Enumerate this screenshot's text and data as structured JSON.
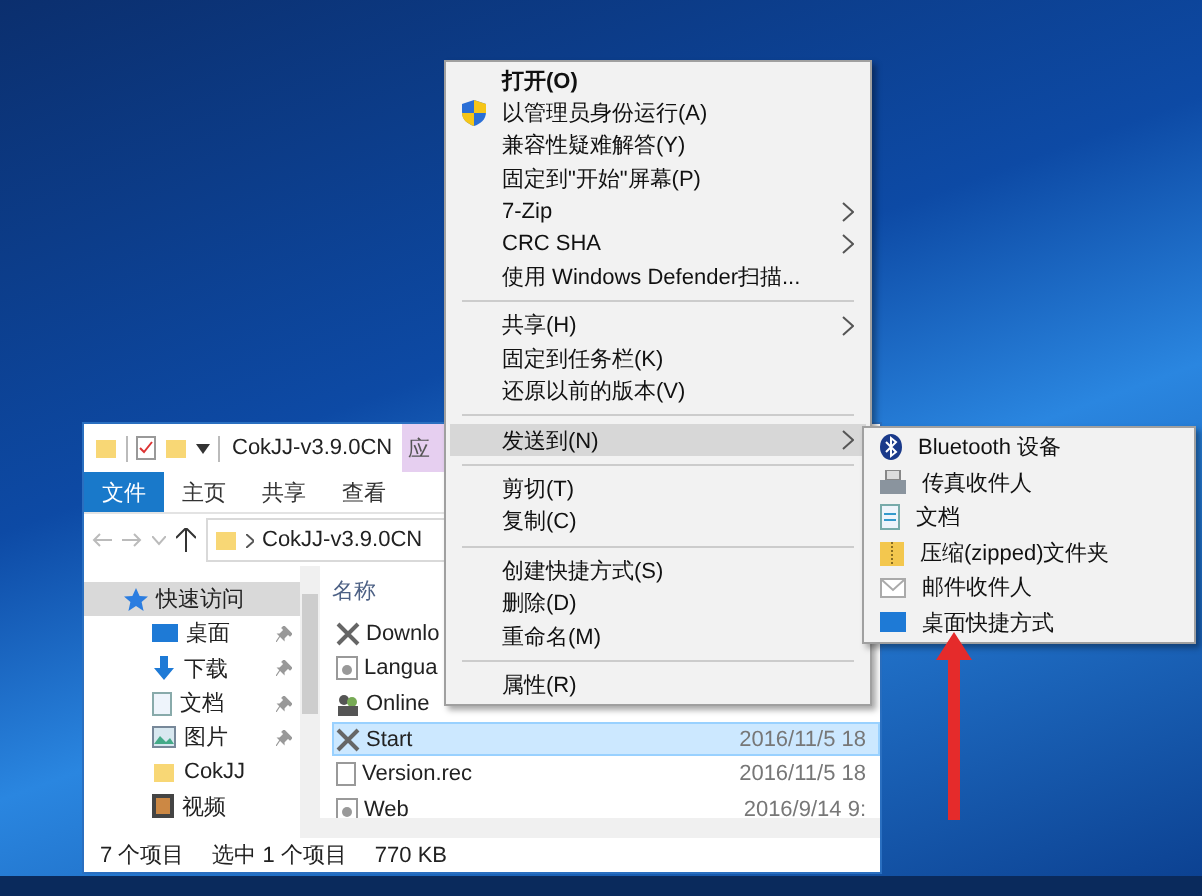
{
  "explorer": {
    "title": "CokJJ-v3.9.0CN",
    "context_tab": "应",
    "ribbon_tabs": [
      {
        "label": "文件",
        "selected": true
      },
      {
        "label": "主页",
        "selected": false
      },
      {
        "label": "共享",
        "selected": false
      },
      {
        "label": "查看",
        "selected": false
      }
    ],
    "address": "CokJJ-v3.9.0CN",
    "nav_items": [
      {
        "label": "快速访问",
        "kind": "star",
        "pinned": false,
        "selected": true
      },
      {
        "label": "桌面",
        "kind": "desktop",
        "pinned": true,
        "selected": false
      },
      {
        "label": "下载",
        "kind": "download",
        "pinned": true,
        "selected": false
      },
      {
        "label": "文档",
        "kind": "document",
        "pinned": true,
        "selected": false
      },
      {
        "label": "图片",
        "kind": "picture",
        "pinned": true,
        "selected": false
      },
      {
        "label": "CokJJ",
        "kind": "folder",
        "pinned": false,
        "selected": false
      },
      {
        "label": "视频",
        "kind": "video",
        "pinned": false,
        "selected": false
      }
    ],
    "name_header": "名称",
    "files": [
      {
        "name": "Downlo",
        "kind": "tool",
        "selected": false
      },
      {
        "name": "Langua",
        "kind": "gear",
        "selected": false
      },
      {
        "name": "Online",
        "kind": "people",
        "selected": false
      },
      {
        "name": "Start",
        "kind": "tool",
        "date": "2016/11/5 18",
        "selected": true
      },
      {
        "name": "Version.rec",
        "kind": "file",
        "date": "2016/11/5 18",
        "selected": false
      },
      {
        "name": "Web",
        "kind": "gear",
        "date": "2016/9/14 9:",
        "selected": false
      }
    ],
    "status": {
      "count": "7 个项目",
      "selection": "选中 1 个项目",
      "size": "770 KB"
    }
  },
  "context_menu": [
    {
      "kind": "item",
      "label": "打开(O)",
      "bold": true,
      "shield": false,
      "submenu": false,
      "selected": false
    },
    {
      "kind": "item",
      "label": "以管理员身份运行(A)",
      "bold": false,
      "shield": true,
      "submenu": false,
      "selected": false
    },
    {
      "kind": "item",
      "label": "兼容性疑难解答(Y)",
      "bold": false,
      "shield": false,
      "submenu": false,
      "selected": false
    },
    {
      "kind": "item",
      "label": "固定到\"开始\"屏幕(P)",
      "bold": false,
      "shield": false,
      "submenu": false,
      "selected": false
    },
    {
      "kind": "item",
      "label": "7-Zip",
      "bold": false,
      "shield": false,
      "submenu": true,
      "selected": false
    },
    {
      "kind": "item",
      "label": "CRC SHA",
      "bold": false,
      "shield": false,
      "submenu": true,
      "selected": false
    },
    {
      "kind": "item",
      "label": "使用 Windows Defender扫描...",
      "bold": false,
      "shield": false,
      "submenu": false,
      "selected": false
    },
    {
      "kind": "separator"
    },
    {
      "kind": "item",
      "label": "共享(H)",
      "bold": false,
      "shield": false,
      "submenu": true,
      "selected": false
    },
    {
      "kind": "item",
      "label": "固定到任务栏(K)",
      "bold": false,
      "shield": false,
      "submenu": false,
      "selected": false
    },
    {
      "kind": "item",
      "label": "还原以前的版本(V)",
      "bold": false,
      "shield": false,
      "submenu": false,
      "selected": false
    },
    {
      "kind": "separator"
    },
    {
      "kind": "item",
      "label": "发送到(N)",
      "bold": false,
      "shield": false,
      "submenu": true,
      "selected": true
    },
    {
      "kind": "separator"
    },
    {
      "kind": "item",
      "label": "剪切(T)",
      "bold": false,
      "shield": false,
      "submenu": false,
      "selected": false
    },
    {
      "kind": "item",
      "label": "复制(C)",
      "bold": false,
      "shield": false,
      "submenu": false,
      "selected": false
    },
    {
      "kind": "separator"
    },
    {
      "kind": "item",
      "label": "创建快捷方式(S)",
      "bold": false,
      "shield": false,
      "submenu": false,
      "selected": false
    },
    {
      "kind": "item",
      "label": "删除(D)",
      "bold": false,
      "shield": false,
      "submenu": false,
      "selected": false
    },
    {
      "kind": "item",
      "label": "重命名(M)",
      "bold": false,
      "shield": false,
      "submenu": false,
      "selected": false
    },
    {
      "kind": "separator"
    },
    {
      "kind": "item",
      "label": "属性(R)",
      "bold": false,
      "shield": false,
      "submenu": false,
      "selected": false
    }
  ],
  "send_to_menu": [
    {
      "label": "Bluetooth 设备",
      "kind": "bluetooth"
    },
    {
      "label": "传真收件人",
      "kind": "fax"
    },
    {
      "label": "文档",
      "kind": "document"
    },
    {
      "label": "压缩(zipped)文件夹",
      "kind": "zip"
    },
    {
      "label": "邮件收件人",
      "kind": "mail"
    },
    {
      "label": "桌面快捷方式",
      "kind": "desktop"
    }
  ]
}
